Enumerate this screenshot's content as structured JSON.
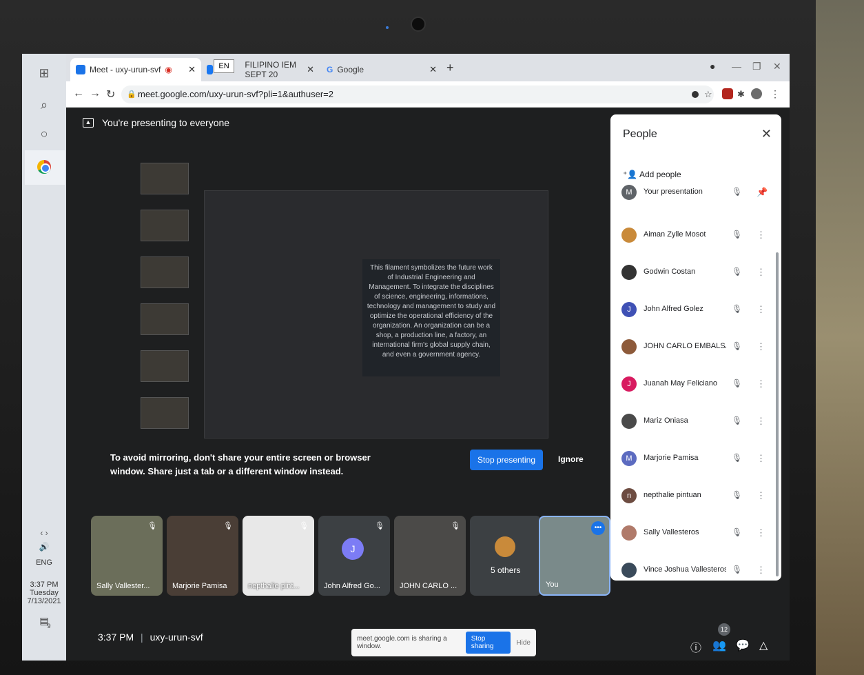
{
  "browser": {
    "tabs": [
      {
        "label": "Meet - uxy-urun-svf",
        "favicon_color": "#1a73e8"
      },
      {
        "label": "FILIPINO IEM SEPT 20",
        "favicon_color": "#1877f2"
      },
      {
        "label": "Google",
        "favicon_color": "#4285f4"
      }
    ],
    "language_indicator": "EN",
    "url": "meet.google.com/uxy-urun-svf?pli=1&authuser=2"
  },
  "meet": {
    "presenting_banner": "You're presenting to everyone",
    "slide_text": "This filament symbolizes the future work of Industrial Engineering and Management. To integrate the disciplines of science, engineering, informations, technology and management to study and optimize the operational efficiency of the organization. An organization can be a shop, a production line, a factory, an international firm's global supply chain, and even a government agency.",
    "mirror_warning": "To avoid mirroring, don't share your entire screen or browser window. Share just a tab or a different window instead.",
    "stop_presenting": "Stop presenting",
    "ignore": "Ignore",
    "tiles": [
      {
        "name": "Sally Vallester..."
      },
      {
        "name": "Marjorie Pamisa"
      },
      {
        "name": "nepthalie pint..."
      },
      {
        "name": "John Alfred Go...",
        "initial": "J"
      },
      {
        "name": "JOHN CARLO ..."
      },
      {
        "name": "5 others"
      },
      {
        "name": "You"
      }
    ],
    "time": "3:37 PM",
    "separator": "|",
    "meeting_code": "uxy-urun-svf",
    "share_notice": "meet.google.com is sharing a window.",
    "stop_sharing": "Stop sharing",
    "hide": "Hide",
    "people_count": "12"
  },
  "people": {
    "title": "People",
    "add_people": "Add people",
    "list": [
      {
        "name": "Your presentation",
        "initial": "M",
        "color": "#5f6368"
      },
      {
        "name": "Aiman Zylle Mosot",
        "initial": "",
        "color": "#c98a3a"
      },
      {
        "name": "Godwin Costan",
        "initial": "",
        "color": "#333333"
      },
      {
        "name": "John Alfred Golez",
        "initial": "J",
        "color": "#3f51b5"
      },
      {
        "name": "JOHN CARLO EMBALSA...",
        "initial": "",
        "color": "#8d5a3a"
      },
      {
        "name": "Juanah May Feliciano",
        "initial": "J",
        "color": "#d81b60"
      },
      {
        "name": "Mariz Oniasa",
        "initial": "",
        "color": "#4a4a4a"
      },
      {
        "name": "Marjorie Pamisa",
        "initial": "M",
        "color": "#5c6bc0"
      },
      {
        "name": "nepthalie pintuan",
        "initial": "n",
        "color": "#6d4c41"
      },
      {
        "name": "Sally Vallesteros",
        "initial": "",
        "color": "#b07a6a"
      },
      {
        "name": "Vince Joshua Vallesteros",
        "initial": "",
        "color": "#3a4a5a"
      }
    ]
  },
  "taskbar": {
    "lang": "ENG",
    "time": "3:37 PM",
    "day": "Tuesday",
    "date": "7/13/2021",
    "notif_count": "9"
  }
}
